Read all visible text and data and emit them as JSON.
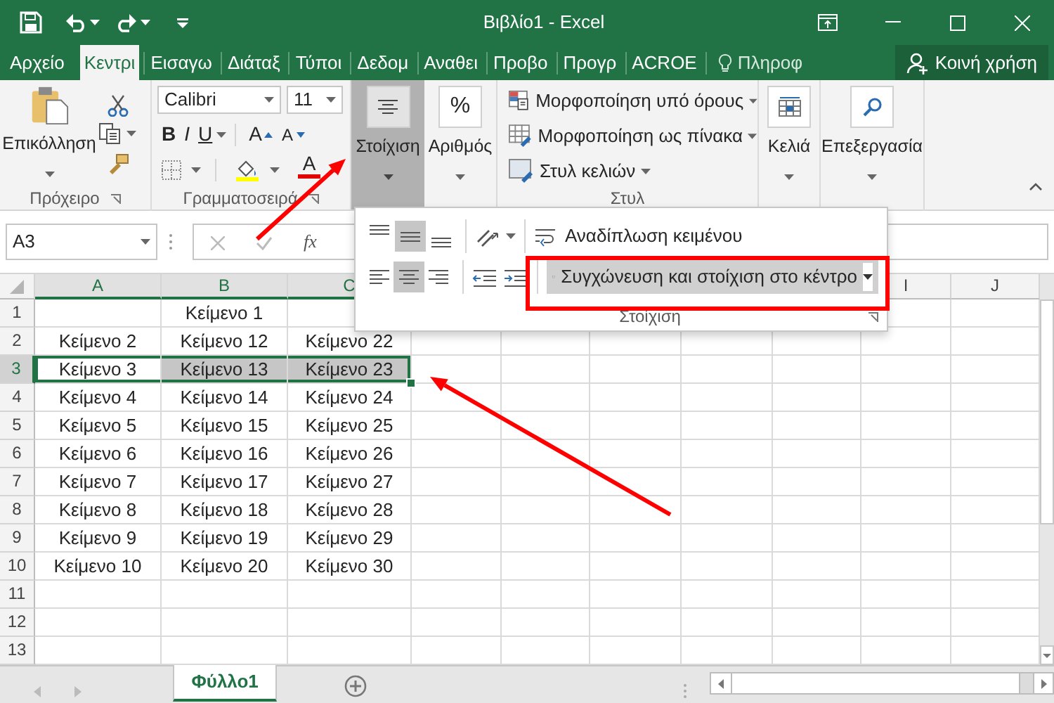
{
  "window": {
    "title": "Βιβλίο1 - Excel"
  },
  "ribbon_tabs": [
    {
      "label": "Αρχείο",
      "selected": false
    },
    {
      "label": "Κεντρι",
      "selected": true
    },
    {
      "label": "Εισαγω",
      "selected": false
    },
    {
      "label": "Διάταξ",
      "selected": false
    },
    {
      "label": "Τύποι",
      "selected": false
    },
    {
      "label": "Δεδομ",
      "selected": false
    },
    {
      "label": "Αναθει",
      "selected": false
    },
    {
      "label": "Προβο",
      "selected": false
    },
    {
      "label": "Προγρ",
      "selected": false
    },
    {
      "label": "ACROE",
      "selected": false
    }
  ],
  "tell_me": {
    "label": "Πληροφ"
  },
  "share": {
    "label": "Κοινή χρήση"
  },
  "clipboard": {
    "paste": "Επικόλληση",
    "title": "Πρόχειρο"
  },
  "font": {
    "name": "Calibri",
    "size": "11",
    "bold": "B",
    "italic": "I",
    "underline": "U",
    "grow": "A",
    "shrink": "A",
    "color_label": "A",
    "title": "Γραμματοσειρά"
  },
  "alignment": {
    "label": "Στοίχιση",
    "selected": true
  },
  "number": {
    "symbol": "%",
    "label": "Αριθμός"
  },
  "styles": {
    "items": [
      "Μορφοποίηση υπό όρους",
      "Μορφοποίηση ως πίνακα",
      "Στυλ κελιών"
    ],
    "title": "Στυλ"
  },
  "cells": {
    "label": "Κελιά"
  },
  "editing": {
    "label": "Επεξεργασία"
  },
  "formula_bar": {
    "name_box": "A3",
    "function_label": "fx"
  },
  "alignment_menu": {
    "vertical": [
      {
        "selected": false
      },
      {
        "selected": true
      },
      {
        "selected": false
      }
    ],
    "horizontal": [
      {
        "selected": false
      },
      {
        "selected": true
      },
      {
        "selected": false
      }
    ],
    "wrap_text": "Αναδίπλωση κειμένου",
    "merge": "Συγχώνευση και στοίχιση στο κέντρο",
    "title": "Στοίχιση"
  },
  "sheet": {
    "columns": [
      "A",
      "B",
      "C",
      null,
      null,
      null,
      null,
      null,
      "I",
      "J"
    ],
    "rows": [
      {
        "label": "1",
        "selected": false,
        "cells": [
          null,
          "Κείμενο 1"
        ]
      },
      {
        "label": "2",
        "selected": false,
        "cells": [
          "Κείμενο 2",
          "Κείμενο 12",
          "Κείμενο 22"
        ]
      },
      {
        "label": "3",
        "selected": true,
        "cells": [
          "Κείμενο 3",
          "Κείμενο 13",
          "Κείμενο 23"
        ]
      },
      {
        "label": "4",
        "selected": false,
        "cells": [
          "Κείμενο 4",
          "Κείμενο 14",
          "Κείμενο 24"
        ]
      },
      {
        "label": "5",
        "selected": false,
        "cells": [
          "Κείμενο 5",
          "Κείμενο 15",
          "Κείμενο 25"
        ]
      },
      {
        "label": "6",
        "selected": false,
        "cells": [
          "Κείμενο 6",
          "Κείμενο 16",
          "Κείμενο 26"
        ]
      },
      {
        "label": "7",
        "selected": false,
        "cells": [
          "Κείμενο 7",
          "Κείμενο 17",
          "Κείμενο 27"
        ]
      },
      {
        "label": "8",
        "selected": false,
        "cells": [
          "Κείμενο 8",
          "Κείμενο 18",
          "Κείμενο 28"
        ]
      },
      {
        "label": "9",
        "selected": false,
        "cells": [
          "Κείμενο 9",
          "Κείμενο 19",
          "Κείμενο 29"
        ]
      },
      {
        "label": "10",
        "selected": false,
        "cells": [
          "Κείμενο 10",
          "Κείμενο 20",
          "Κείμενο 30"
        ]
      },
      {
        "label": "11",
        "selected": false,
        "cells": []
      },
      {
        "label": "12",
        "selected": false,
        "cells": []
      },
      {
        "label": "13",
        "selected": false,
        "cells": []
      }
    ]
  },
  "sheet_tabs": [
    {
      "label": "Φύλλο1",
      "selected": true
    }
  ]
}
